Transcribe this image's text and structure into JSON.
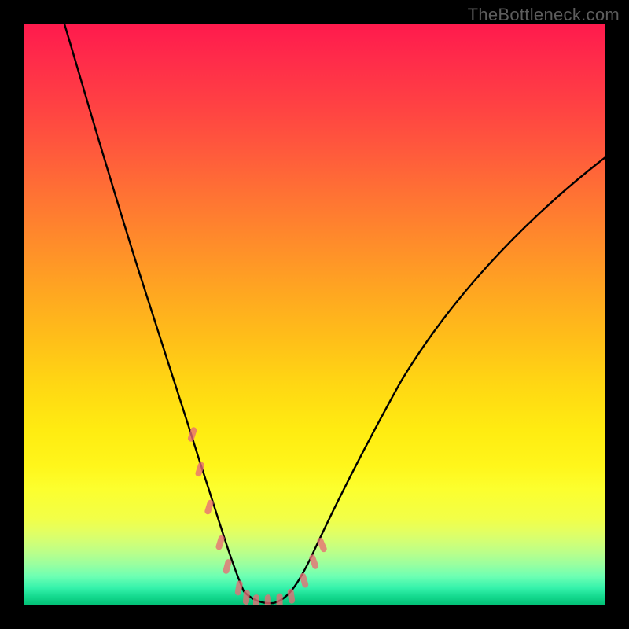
{
  "watermark": "TheBottleneck.com",
  "chart_data": {
    "type": "line",
    "title": "",
    "xlabel": "",
    "ylabel": "",
    "xlim": [
      0,
      100
    ],
    "ylim": [
      0,
      100
    ],
    "series": [
      {
        "name": "bottleneck-curve",
        "x_pct": [
          7,
          10,
          14,
          18,
          22,
          26,
          29,
          31,
          33,
          35,
          37,
          40,
          43,
          46,
          49,
          53,
          58,
          64,
          71,
          79,
          88,
          100
        ],
        "y_pct": [
          100,
          90,
          78,
          66,
          55,
          43,
          33,
          25,
          18,
          12,
          6,
          3,
          1,
          2,
          5,
          10,
          17,
          26,
          36,
          47,
          57,
          68
        ]
      }
    ],
    "markers": {
      "name": "highlight-dots",
      "color": "#e86c74",
      "points_pct": [
        [
          29.0,
          30.0
        ],
        [
          30.3,
          24.0
        ],
        [
          31.9,
          17.5
        ],
        [
          33.8,
          11.4
        ],
        [
          35.0,
          7.3
        ],
        [
          37.0,
          3.6
        ],
        [
          38.3,
          2.0
        ],
        [
          40.0,
          1.2
        ],
        [
          42.0,
          1.2
        ],
        [
          44.0,
          1.4
        ],
        [
          46.0,
          2.2
        ],
        [
          48.2,
          4.9
        ],
        [
          49.9,
          8.1
        ],
        [
          51.3,
          11.0
        ]
      ]
    },
    "annotations": []
  }
}
